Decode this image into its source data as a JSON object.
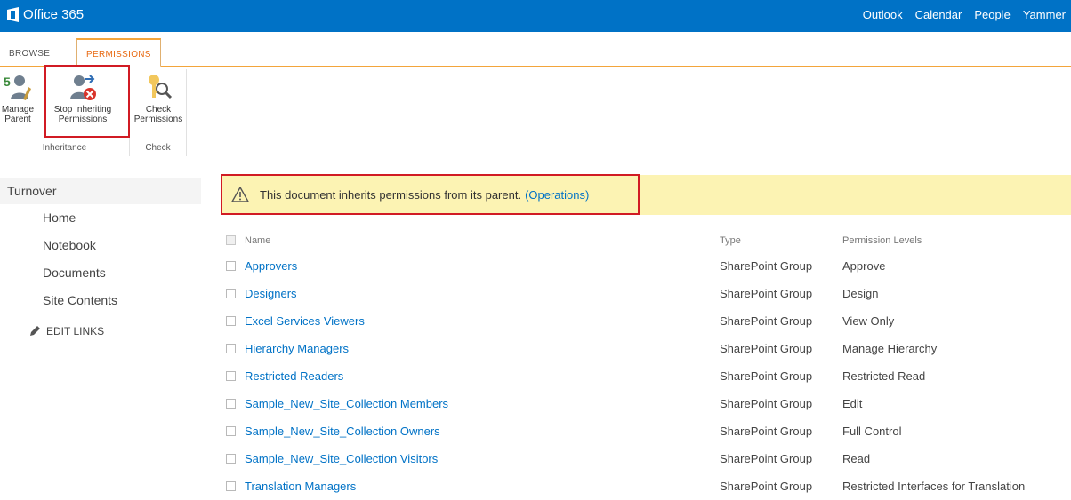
{
  "suite_bar": {
    "brand": "Office 365",
    "links": [
      "Outlook",
      "Calendar",
      "People",
      "Yammer"
    ]
  },
  "ribbon": {
    "tabs": [
      "BROWSE",
      "PERMISSIONS"
    ],
    "groups": {
      "inheritance": {
        "label": "Inheritance",
        "manage_parent": [
          "Manage",
          "Parent"
        ],
        "stop_inheriting": [
          "Stop Inheriting",
          "Permissions"
        ]
      },
      "check": {
        "label": "Check",
        "check_permissions": [
          "Check",
          "Permissions"
        ]
      }
    }
  },
  "left_nav": {
    "root": "Turnover",
    "items": [
      "Home",
      "Notebook",
      "Documents",
      "Site Contents"
    ],
    "edit_links": "EDIT LINKS"
  },
  "status": {
    "message": "This document inherits permissions from its parent.",
    "link": "(Operations)"
  },
  "table": {
    "headers": {
      "name": "Name",
      "type": "Type",
      "permission": "Permission Levels"
    },
    "rows": [
      {
        "name": "Approvers",
        "type": "SharePoint Group",
        "permission": "Approve"
      },
      {
        "name": "Designers",
        "type": "SharePoint Group",
        "permission": "Design"
      },
      {
        "name": "Excel Services Viewers",
        "type": "SharePoint Group",
        "permission": "View Only"
      },
      {
        "name": "Hierarchy Managers",
        "type": "SharePoint Group",
        "permission": "Manage Hierarchy"
      },
      {
        "name": "Restricted Readers",
        "type": "SharePoint Group",
        "permission": "Restricted Read"
      },
      {
        "name": "Sample_New_Site_Collection Members",
        "type": "SharePoint Group",
        "permission": "Edit"
      },
      {
        "name": "Sample_New_Site_Collection Owners",
        "type": "SharePoint Group",
        "permission": "Full Control"
      },
      {
        "name": "Sample_New_Site_Collection Visitors",
        "type": "SharePoint Group",
        "permission": "Read"
      },
      {
        "name": "Translation Managers",
        "type": "SharePoint Group",
        "permission": "Restricted Interfaces for Translation"
      }
    ]
  },
  "colors": {
    "suite_bar": "#0072c6",
    "accent_tab": "#e86a13",
    "status_background": "#fcf3b3",
    "callout_border": "#d11b24",
    "link": "#0072c6"
  }
}
